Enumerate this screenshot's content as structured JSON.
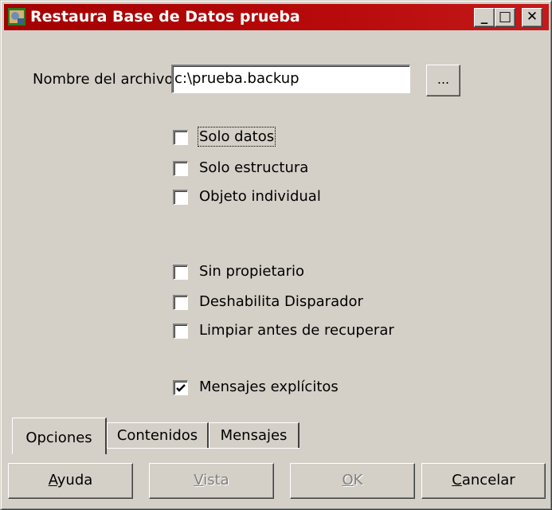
{
  "window": {
    "title": "Restaura Base de Datos prueba",
    "controls": {
      "minimize": "_",
      "maximize": "□",
      "close": "✕"
    }
  },
  "form": {
    "filename_label": "Nombre del archivo",
    "filename_value": "c:\\prueba.backup",
    "browse_label": "..."
  },
  "options": [
    {
      "label": "Solo datos",
      "checked": false
    },
    {
      "label": "Solo estructura",
      "checked": false
    },
    {
      "label": "Objeto individual",
      "checked": false
    },
    {
      "label": "Sin propietario",
      "checked": false
    },
    {
      "label": "Deshabilita Disparador",
      "checked": false
    },
    {
      "label": "Limpiar antes de recuperar",
      "checked": false
    },
    {
      "label": "Mensajes explícitos",
      "checked": true
    }
  ],
  "tabs": [
    {
      "label": "Opciones",
      "active": true
    },
    {
      "label": "Contenidos",
      "active": false
    },
    {
      "label": "Mensajes",
      "active": false
    }
  ],
  "buttons": {
    "help": {
      "mnemonic": "A",
      "rest": "yuda"
    },
    "view": {
      "mnemonic": "V",
      "rest": "ista",
      "disabled": true
    },
    "ok": {
      "mnemonic": "O",
      "rest": "K",
      "disabled": true
    },
    "cancel": {
      "mnemonic": "C",
      "rest": "ancelar"
    }
  },
  "colors": {
    "titlebar": "#a40000",
    "face": "#d4d0c8"
  }
}
